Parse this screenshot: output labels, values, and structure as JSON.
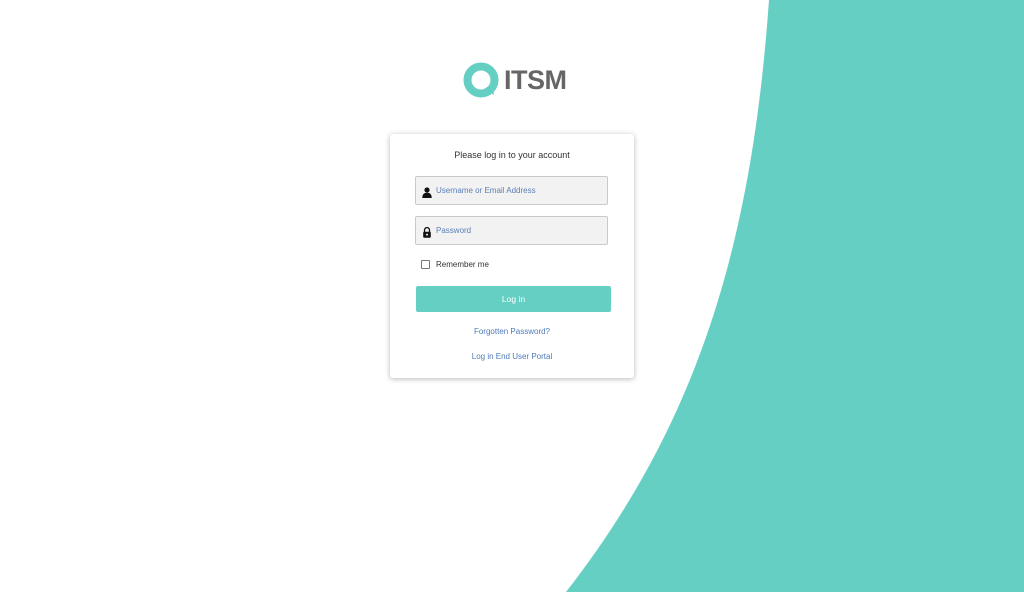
{
  "colors": {
    "accent": "#66cfc3",
    "logo_text": "#666666",
    "link": "#4e7bbb"
  },
  "logo": {
    "text": "ITSM"
  },
  "login": {
    "title": "Please log in to your account",
    "username_placeholder": "Username or Email Address",
    "password_placeholder": "Password",
    "remember_label": "Remember me",
    "submit_label": "Log in",
    "forgot_link": "Forgotten Password?",
    "portal_link": "Log in End User Portal"
  },
  "icons": {
    "username": "user-icon",
    "password": "lock-icon"
  }
}
